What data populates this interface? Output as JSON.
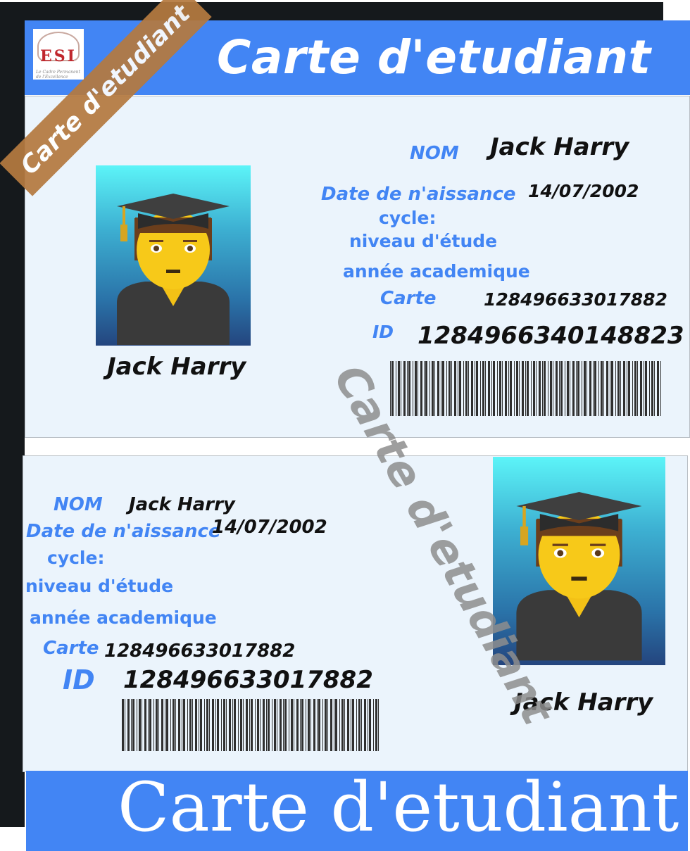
{
  "header": {
    "title": "Carte d'etudiant"
  },
  "logo": {
    "text": "ESI",
    "motto": "Le Cadre Permanent de l'Excellence"
  },
  "ribbon": {
    "text": "Carte d'etudiant"
  },
  "watermark": {
    "text": "Carte d'etudiant"
  },
  "card_front": {
    "nom_label": "NOM",
    "nom_value": "Jack Harry",
    "dob_label": "Date de n'aissance",
    "dob_value": "14/07/2002",
    "cycle_label": "cycle:",
    "niveau_label": "niveau d'étude",
    "annee_label": "année academique",
    "carte_label": "Carte",
    "carte_value": "128496633017882",
    "id_label": "ID",
    "id_value": "1284966340148823",
    "photo_name": "Jack Harry",
    "photo_icon": "student-graduate-icon"
  },
  "card_back": {
    "nom_label": "NOM",
    "nom_value": "Jack Harry",
    "dob_label": "Date de n'aissance",
    "dob_value": "14/07/2002",
    "cycle_label": "cycle:",
    "niveau_label": "niveau d'étude",
    "annee_label": "année academique",
    "carte_label": "Carte",
    "carte_value": "128496633017882",
    "id_label": "ID",
    "id_value": "128496633017882",
    "photo_name": "Jack Harry",
    "photo_icon": "student-graduate-icon"
  },
  "footer": {
    "title": "Carte d'etudiant"
  },
  "colors": {
    "accent": "#4285f4",
    "panel": "#ebf4fc",
    "ribbon": "#b57a40",
    "dark": "#15191c"
  }
}
